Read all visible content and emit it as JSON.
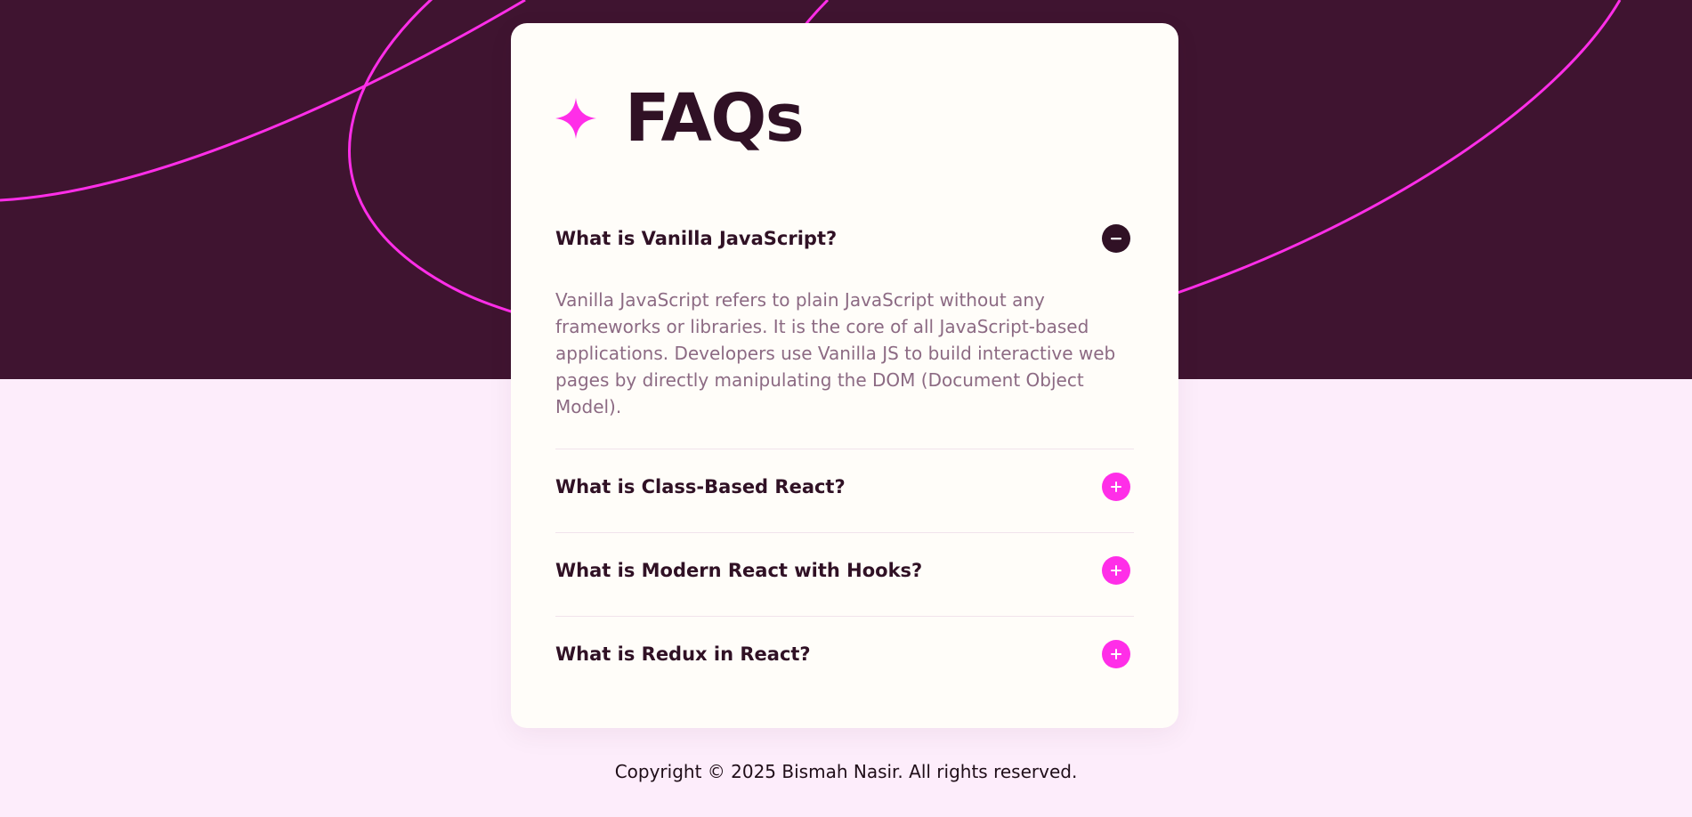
{
  "colors": {
    "hero_background": "#3f1430",
    "page_background": "#fdedfb",
    "card_background": "#fffdf9",
    "accent_pink": "#ff2ee8",
    "heading_dark": "#301125",
    "answer_text": "#8c6a83"
  },
  "header": {
    "icon": "four-point-star-icon",
    "title": "FAQs"
  },
  "faqs": [
    {
      "question": "What is Vanilla JavaScript?",
      "expanded": true,
      "toggle_icon": "minus-circle-icon",
      "answer": "Vanilla JavaScript refers to plain JavaScript without any frameworks or libraries. It is the core of all JavaScript-based applications. Developers use Vanilla JS to build interactive web pages by directly manipulating the DOM (Document Object Model)."
    },
    {
      "question": "What is Class-Based React?",
      "expanded": false,
      "toggle_icon": "plus-circle-icon"
    },
    {
      "question": "What is Modern React with Hooks?",
      "expanded": false,
      "toggle_icon": "plus-circle-icon"
    },
    {
      "question": "What is Redux in React?",
      "expanded": false,
      "toggle_icon": "plus-circle-icon"
    }
  ],
  "footer": {
    "copyright": "Copyright © 2025 Bismah Nasir. All rights reserved."
  }
}
